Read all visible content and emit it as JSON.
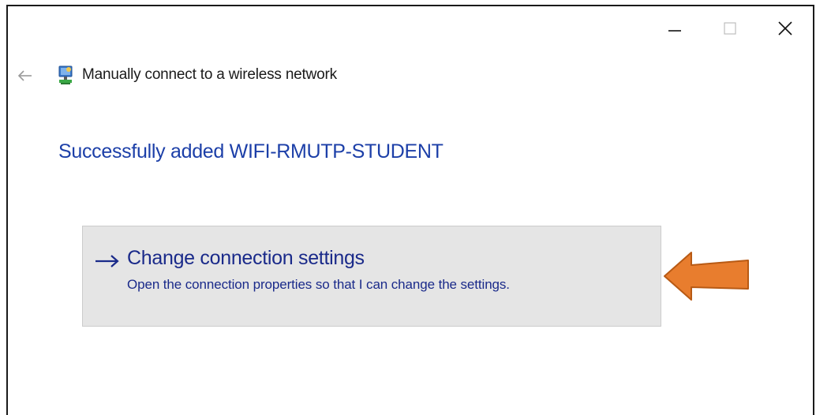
{
  "window": {
    "title": "Manually connect to a wireless network",
    "controls": {
      "minimize_icon": "minimize-icon",
      "maximize_icon": "maximize-icon",
      "close_icon": "close-icon"
    },
    "back_icon": "back-arrow-icon",
    "network_icon": "network-icon"
  },
  "main": {
    "success_message": "Successfully added WIFI-RMUTP-STUDENT",
    "option": {
      "arrow_icon": "arrow-right-icon",
      "title": "Change connection settings",
      "description": "Open the connection properties so that I can change the settings."
    }
  },
  "annotation": {
    "pointer_icon": "orange-arrow-icon",
    "color": "#e87d2e"
  },
  "colors": {
    "accent_blue": "#1c3fa8",
    "link_blue": "#1a2a8a",
    "card_bg": "#e5e5e5"
  }
}
